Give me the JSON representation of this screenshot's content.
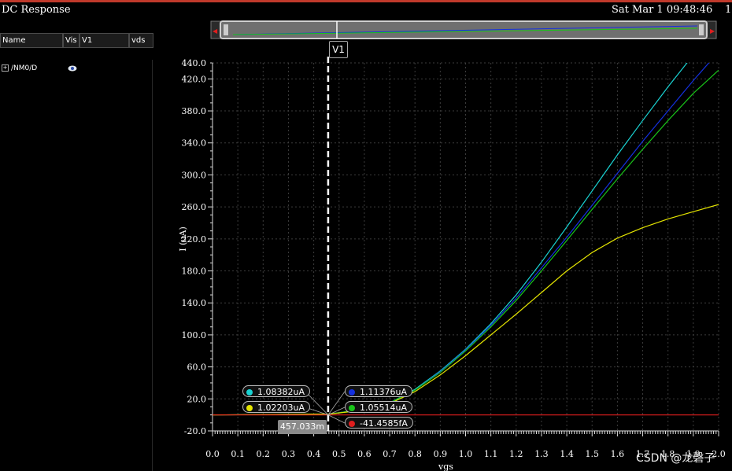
{
  "window": {
    "title": "DC Response",
    "datetime": "Sat Mar 1 09:48:46",
    "corner_text": "1"
  },
  "signal_table": {
    "headers": [
      "Name",
      "Vis",
      "V1",
      "vds"
    ],
    "rows": [
      {
        "expander": "+",
        "name": "/NM0/D",
        "visible_icon": "eye-icon"
      }
    ]
  },
  "cursor": {
    "name": "V1",
    "x_readout": "457.033m",
    "x_value": 0.457
  },
  "markers": [
    {
      "label": "1.08382uA",
      "color": "#19d3d3"
    },
    {
      "label": "1.02203uA",
      "color": "#e4e400"
    },
    {
      "label": "1.11376uA",
      "color": "#1430e0"
    },
    {
      "label": "1.05514uA",
      "color": "#19c419"
    },
    {
      "label": "-41.4585fA",
      "color": "#e01e1e"
    }
  ],
  "watermark": "CSDN @龙磬子",
  "chart_data": {
    "type": "line",
    "title": "",
    "xlabel": "vgs",
    "ylabel": "I (uA)",
    "xlim": [
      0.0,
      2.0
    ],
    "ylim": [
      -20.0,
      440.0
    ],
    "x_ticks": [
      "0.0",
      "0.1",
      "0.2",
      "0.3",
      "0.4",
      "0.5",
      "0.6",
      "0.7",
      "0.8",
      "0.9",
      "1.0",
      "1.1",
      "1.2",
      "1.3",
      "1.4",
      "1.5",
      "1.6",
      "1.7",
      "1.8",
      "1.9",
      "2.0"
    ],
    "y_ticks": [
      "-20.0",
      "20.0",
      "60.0",
      "100.0",
      "140.0",
      "180.0",
      "220.0",
      "260.0",
      "300.0",
      "340.0",
      "380.0",
      "420.0",
      "440.0"
    ],
    "grid": true,
    "series": [
      {
        "color": "#19d3d3",
        "x": [
          0.0,
          0.46,
          0.6,
          0.7,
          0.8,
          0.9,
          1.0,
          1.1,
          1.2,
          1.3,
          1.4,
          1.5,
          1.6,
          1.7,
          1.8,
          1.9,
          2.0
        ],
        "y": [
          0.0,
          1.08,
          7,
          15,
          32,
          55,
          82,
          114,
          150,
          191,
          235,
          280,
          325,
          368,
          410,
          450,
          488
        ]
      },
      {
        "color": "#1430e0",
        "x": [
          0.0,
          0.46,
          0.6,
          0.7,
          0.8,
          0.9,
          1.0,
          1.1,
          1.2,
          1.3,
          1.4,
          1.5,
          1.6,
          1.7,
          1.8,
          1.9,
          2.0
        ],
        "y": [
          0.0,
          1.11,
          7,
          15,
          31,
          54,
          81,
          112,
          146,
          184,
          222,
          262,
          302,
          342,
          380,
          418,
          454
        ]
      },
      {
        "color": "#19c419",
        "x": [
          0.0,
          0.46,
          0.6,
          0.7,
          0.8,
          0.9,
          1.0,
          1.1,
          1.2,
          1.3,
          1.4,
          1.5,
          1.6,
          1.7,
          1.8,
          1.9,
          2.0
        ],
        "y": [
          0.0,
          1.06,
          7,
          15,
          31,
          53,
          80,
          110,
          143,
          180,
          218,
          257,
          295,
          332,
          368,
          402,
          431
        ]
      },
      {
        "color": "#e4e400",
        "x": [
          0.0,
          0.46,
          0.6,
          0.7,
          0.8,
          0.9,
          1.0,
          1.1,
          1.2,
          1.3,
          1.4,
          1.5,
          1.6,
          1.7,
          1.8,
          1.9,
          2.0
        ],
        "y": [
          0.0,
          1.02,
          6,
          14,
          29,
          50,
          74,
          100,
          126,
          153,
          180,
          203,
          221,
          234,
          245,
          254,
          263
        ]
      },
      {
        "color": "#e01e1e",
        "x": [
          0.0,
          2.0
        ],
        "y": [
          0.0,
          0.0
        ]
      }
    ]
  },
  "overview_bar": {
    "arrow_left": "◀",
    "arrow_right": "▶"
  }
}
